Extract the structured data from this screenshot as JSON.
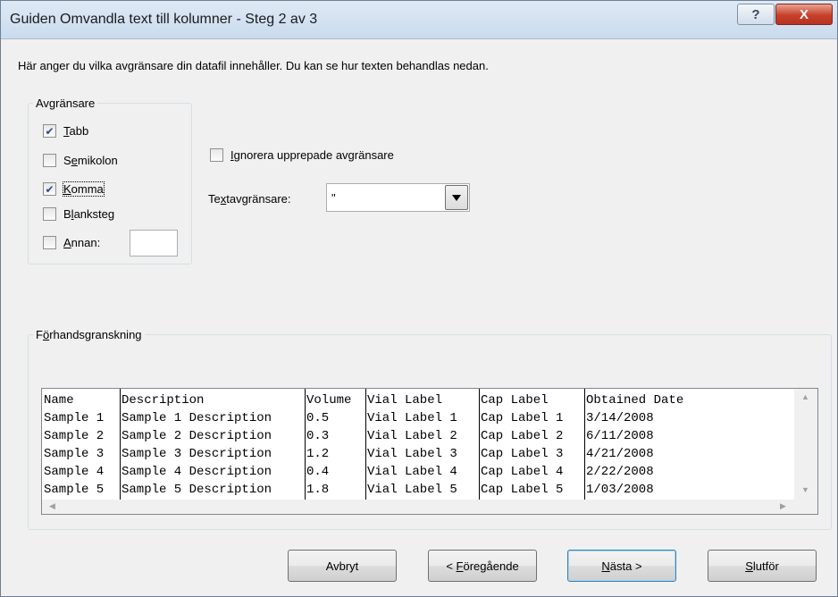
{
  "window": {
    "title": "Guiden Omvandla text till kolumner - Steg 2 av 3",
    "help_glyph": "?",
    "close_glyph": "X"
  },
  "intro": "Här anger du vilka avgränsare din datafil innehåller. Du kan se hur texten behandlas nedan.",
  "delimiters": {
    "legend": "Avgränsare",
    "tab": {
      "pre": "",
      "key": "T",
      "post": "abb",
      "checked": true
    },
    "semicolon": {
      "pre": "S",
      "key": "e",
      "post": "mikolon",
      "checked": false
    },
    "comma": {
      "pre": "",
      "key": "K",
      "post": "omma",
      "checked": true
    },
    "space": {
      "pre": "B",
      "key": "l",
      "post": "anksteg",
      "checked": false
    },
    "other": {
      "pre": "",
      "key": "A",
      "post": "nnan:",
      "checked": false,
      "value": ""
    }
  },
  "options": {
    "ignore_repeated": {
      "pre": "",
      "key": "I",
      "post": "gnorera upprepade avgränsare",
      "checked": false
    },
    "text_qualifier": {
      "pre": "Te",
      "key": "x",
      "post": "tavgränsare:",
      "value": "\""
    }
  },
  "preview": {
    "legend_pre": "F",
    "legend_key": "ö",
    "legend_post": "rhandsgranskning",
    "rows": [
      [
        "Name",
        "Description",
        "Volume",
        "Vial Label",
        "Cap Label",
        "Obtained Date"
      ],
      [
        "Sample 1",
        "Sample 1 Description",
        "0.5",
        "Vial Label 1",
        "Cap Label 1",
        "3/14/2008"
      ],
      [
        "Sample 2",
        "Sample 2 Description",
        "0.3",
        "Vial Label 2",
        "Cap Label 2",
        "6/11/2008"
      ],
      [
        "Sample 3",
        "Sample 3 Description",
        "1.2",
        "Vial Label 3",
        "Cap Label 3",
        "4/21/2008"
      ],
      [
        "Sample 4",
        "Sample 4 Description",
        "0.4",
        "Vial Label 4",
        "Cap Label 4",
        "2/22/2008"
      ],
      [
        "Sample 5",
        "Sample 5 Description",
        "1.8",
        "Vial Label 5",
        "Cap Label 5",
        "1/03/2008"
      ]
    ]
  },
  "buttons": {
    "cancel": {
      "pre": "Avbryt",
      "key": "",
      "post": ""
    },
    "back": {
      "pre": "< ",
      "key": "F",
      "post": "öregående"
    },
    "next": {
      "pre": "",
      "key": "N",
      "post": "ästa >"
    },
    "finish": {
      "pre": "",
      "key": "S",
      "post": "lutför"
    }
  },
  "colors": {
    "title_bar": "#c9dbee",
    "close_button": "#c7402a",
    "check_mark": "#2a4a8f"
  }
}
